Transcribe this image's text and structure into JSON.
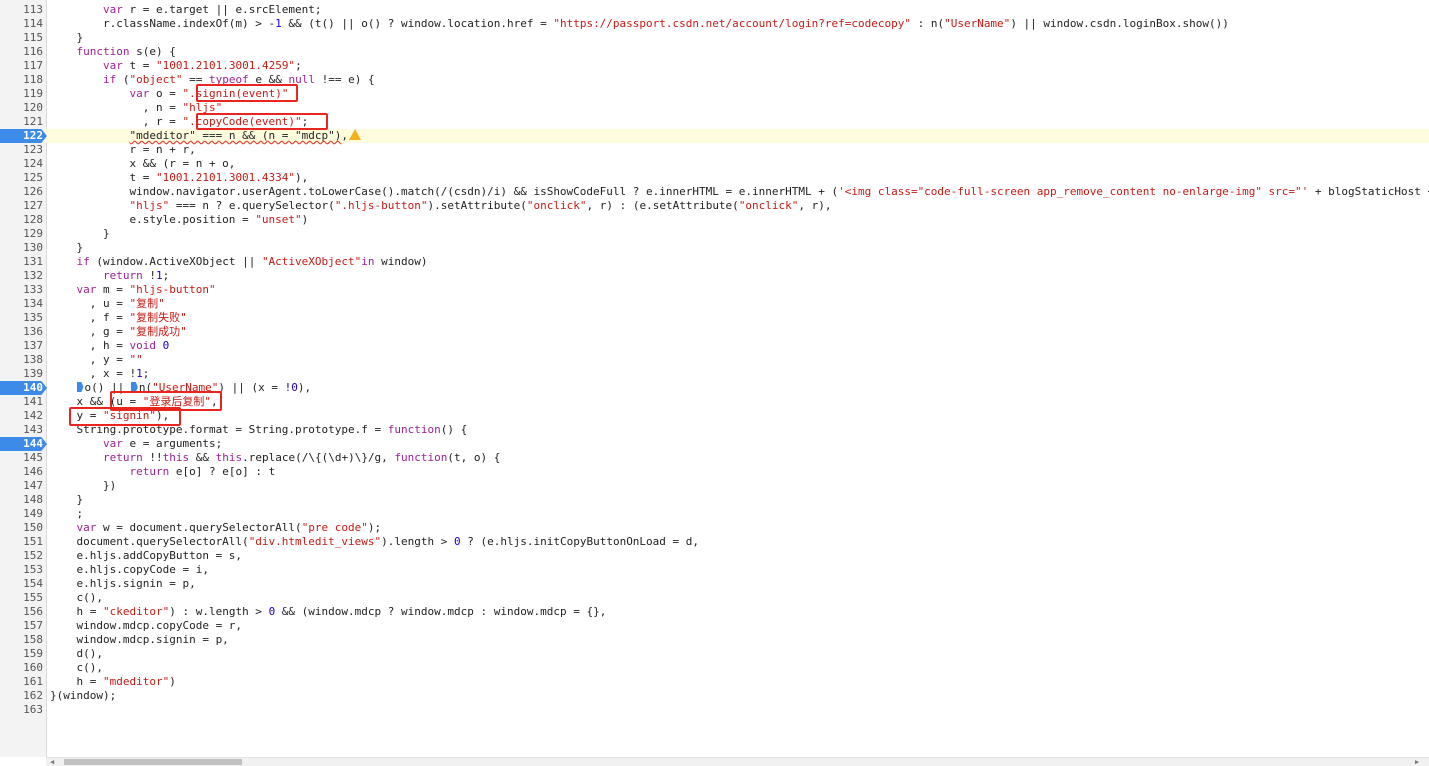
{
  "editor": {
    "highlighted_line": 122,
    "breakpoint_lines": [
      122,
      140,
      144
    ],
    "lines": [
      {
        "n": "113",
        "tokens": [
          [
            "p",
            "        "
          ],
          [
            "k",
            "var"
          ],
          [
            "p",
            " r = e.target || e.srcElement;"
          ]
        ]
      },
      {
        "n": "114",
        "tokens": [
          [
            "p",
            "        r.className.indexOf(m) > -"
          ],
          [
            "n",
            "1"
          ],
          [
            "p",
            " && (t() || o() ? window.location.href = "
          ],
          [
            "s",
            "\"https://passport.csdn.net/account/login?ref=codecopy\""
          ],
          [
            "p",
            " : n("
          ],
          [
            "s",
            "\"UserName\""
          ],
          [
            "p",
            ") || window.csdn.loginBox.show())"
          ]
        ]
      },
      {
        "n": "115",
        "tokens": [
          [
            "p",
            "    }"
          ]
        ]
      },
      {
        "n": "116",
        "tokens": [
          [
            "p",
            "    "
          ],
          [
            "k",
            "function"
          ],
          [
            "p",
            " s(e) {"
          ]
        ]
      },
      {
        "n": "117",
        "tokens": [
          [
            "p",
            "        "
          ],
          [
            "k",
            "var"
          ],
          [
            "p",
            " t = "
          ],
          [
            "s",
            "\"1001.2101.3001.4259\""
          ],
          [
            "p",
            ";"
          ]
        ]
      },
      {
        "n": "118",
        "tokens": [
          [
            "p",
            "        "
          ],
          [
            "k",
            "if"
          ],
          [
            "p",
            " ("
          ],
          [
            "s",
            "\"object\""
          ],
          [
            "p",
            " == "
          ],
          [
            "k",
            "typeof"
          ],
          [
            "p",
            " e && "
          ],
          [
            "k",
            "null"
          ],
          [
            "p",
            " !== e) {"
          ]
        ]
      },
      {
        "n": "119",
        "tokens": [
          [
            "p",
            "            "
          ],
          [
            "k",
            "var"
          ],
          [
            "p",
            " o = "
          ],
          [
            "s",
            "\".signin(event)\""
          ]
        ]
      },
      {
        "n": "120",
        "tokens": [
          [
            "p",
            "              , n = "
          ],
          [
            "s",
            "\"hljs\""
          ]
        ]
      },
      {
        "n": "121",
        "tokens": [
          [
            "p",
            "              , r = "
          ],
          [
            "s",
            "\".copyCode(event)\""
          ],
          [
            "p",
            ";"
          ]
        ]
      },
      {
        "n": "122",
        "tokens": [
          [
            "p",
            "            "
          ],
          [
            "sq",
            "\"mdeditor\" === n && (n = \"mdcp\")"
          ],
          [
            "p",
            ","
          ],
          [
            "warn",
            ""
          ]
        ]
      },
      {
        "n": "123",
        "tokens": [
          [
            "p",
            "            r = n + r,"
          ]
        ]
      },
      {
        "n": "124",
        "tokens": [
          [
            "p",
            "            x && (r = n + o,"
          ]
        ]
      },
      {
        "n": "125",
        "tokens": [
          [
            "p",
            "            t = "
          ],
          [
            "s",
            "\"1001.2101.3001.4334\""
          ],
          [
            "p",
            "),"
          ]
        ]
      },
      {
        "n": "126",
        "tokens": [
          [
            "p",
            "            window.navigator.userAgent.toLowerCase().match(/(csdn)/i) && isShowCodeFull ? e.innerHTML = e.innerHTML + ("
          ],
          [
            "s",
            "'<img class=\"code-full-screen app_remove_content no-enlarge-img\" src=\"'"
          ],
          [
            "p",
            " + blogStaticHost +"
          ]
        ]
      },
      {
        "n": "127",
        "tokens": [
          [
            "p",
            "            "
          ],
          [
            "s",
            "\"hljs\""
          ],
          [
            "p",
            " === n ? e.querySelector("
          ],
          [
            "s",
            "\".hljs-button\""
          ],
          [
            "p",
            ").setAttribute("
          ],
          [
            "s",
            "\"onclick\""
          ],
          [
            "p",
            ", r) : (e.setAttribute("
          ],
          [
            "s",
            "\"onclick\""
          ],
          [
            "p",
            ", r),"
          ]
        ]
      },
      {
        "n": "128",
        "tokens": [
          [
            "p",
            "            e.style.position = "
          ],
          [
            "s",
            "\"unset\""
          ],
          [
            "p",
            ")"
          ]
        ]
      },
      {
        "n": "129",
        "tokens": [
          [
            "p",
            "        }"
          ]
        ]
      },
      {
        "n": "130",
        "tokens": [
          [
            "p",
            "    }"
          ]
        ]
      },
      {
        "n": "131",
        "tokens": [
          [
            "p",
            "    "
          ],
          [
            "k",
            "if"
          ],
          [
            "p",
            " (window.ActiveXObject || "
          ],
          [
            "s",
            "\"ActiveXObject\""
          ],
          [
            "k",
            "in"
          ],
          [
            "p",
            " window)"
          ]
        ]
      },
      {
        "n": "132",
        "tokens": [
          [
            "p",
            "        "
          ],
          [
            "k",
            "return"
          ],
          [
            "p",
            " !"
          ],
          [
            "n",
            "1"
          ],
          [
            "p",
            ";"
          ]
        ]
      },
      {
        "n": "133",
        "tokens": [
          [
            "p",
            "    "
          ],
          [
            "k",
            "var"
          ],
          [
            "p",
            " m = "
          ],
          [
            "s",
            "\"hljs-button\""
          ]
        ]
      },
      {
        "n": "134",
        "tokens": [
          [
            "p",
            "      , u = "
          ],
          [
            "s",
            "\"复制\""
          ]
        ]
      },
      {
        "n": "135",
        "tokens": [
          [
            "p",
            "      , f = "
          ],
          [
            "s",
            "\"复制失败\""
          ]
        ]
      },
      {
        "n": "136",
        "tokens": [
          [
            "p",
            "      , g = "
          ],
          [
            "s",
            "\"复制成功\""
          ]
        ]
      },
      {
        "n": "137",
        "tokens": [
          [
            "p",
            "      , h = "
          ],
          [
            "k",
            "void"
          ],
          [
            "p",
            " "
          ],
          [
            "n",
            "0"
          ]
        ]
      },
      {
        "n": "138",
        "tokens": [
          [
            "p",
            "      , y = "
          ],
          [
            "s",
            "\"\""
          ]
        ]
      },
      {
        "n": "139",
        "tokens": [
          [
            "p",
            "      , x = !"
          ],
          [
            "n",
            "1"
          ],
          [
            "p",
            ";"
          ]
        ]
      },
      {
        "n": "140",
        "tokens": [
          [
            "p",
            "    "
          ],
          [
            "ibp",
            ""
          ],
          [
            "p",
            "o() || "
          ],
          [
            "ibp",
            ""
          ],
          [
            "p",
            "n("
          ],
          [
            "s",
            "\"UserName\""
          ],
          [
            "p",
            ") || (x = !"
          ],
          [
            "n",
            "0"
          ],
          [
            "p",
            "),"
          ]
        ]
      },
      {
        "n": "141",
        "tokens": [
          [
            "p",
            "    x && (u = "
          ],
          [
            "s",
            "\"登录后复制\""
          ],
          [
            "p",
            ","
          ]
        ]
      },
      {
        "n": "142",
        "tokens": [
          [
            "p",
            "    y = "
          ],
          [
            "s",
            "\"signin\""
          ],
          [
            "p",
            "),"
          ]
        ]
      },
      {
        "n": "143",
        "tokens": [
          [
            "p",
            "    String.prototype.format = String.prototype.f = "
          ],
          [
            "k",
            "function"
          ],
          [
            "p",
            "() {"
          ]
        ]
      },
      {
        "n": "144",
        "tokens": [
          [
            "p",
            "        "
          ],
          [
            "k",
            "var"
          ],
          [
            "p",
            " e = arguments;"
          ]
        ]
      },
      {
        "n": "145",
        "tokens": [
          [
            "p",
            "        "
          ],
          [
            "k",
            "return"
          ],
          [
            "p",
            " !!"
          ],
          [
            "k",
            "this"
          ],
          [
            "p",
            " && "
          ],
          [
            "k",
            "this"
          ],
          [
            "p",
            ".replace(/\\{(\\d+)\\}/g, "
          ],
          [
            "k",
            "function"
          ],
          [
            "p",
            "(t, o) {"
          ]
        ]
      },
      {
        "n": "146",
        "tokens": [
          [
            "p",
            "            "
          ],
          [
            "k",
            "return"
          ],
          [
            "p",
            " e[o] ? e[o] : t"
          ]
        ]
      },
      {
        "n": "147",
        "tokens": [
          [
            "p",
            "        })"
          ]
        ]
      },
      {
        "n": "148",
        "tokens": [
          [
            "p",
            "    }"
          ]
        ]
      },
      {
        "n": "149",
        "tokens": [
          [
            "p",
            "    ;"
          ]
        ]
      },
      {
        "n": "150",
        "tokens": [
          [
            "p",
            "    "
          ],
          [
            "k",
            "var"
          ],
          [
            "p",
            " w = document.querySelectorAll("
          ],
          [
            "s",
            "\"pre code\""
          ],
          [
            "p",
            ");"
          ]
        ]
      },
      {
        "n": "151",
        "tokens": [
          [
            "p",
            "    document.querySelectorAll("
          ],
          [
            "s",
            "\"div.htmledit_views\""
          ],
          [
            "p",
            ").length > "
          ],
          [
            "n",
            "0"
          ],
          [
            "p",
            " ? (e.hljs.initCopyButtonOnLoad = d,"
          ]
        ]
      },
      {
        "n": "152",
        "tokens": [
          [
            "p",
            "    e.hljs.addCopyButton = s,"
          ]
        ]
      },
      {
        "n": "153",
        "tokens": [
          [
            "p",
            "    e.hljs.copyCode = i,"
          ]
        ]
      },
      {
        "n": "154",
        "tokens": [
          [
            "p",
            "    e.hljs.signin = p,"
          ]
        ]
      },
      {
        "n": "155",
        "tokens": [
          [
            "p",
            "    c(),"
          ]
        ]
      },
      {
        "n": "156",
        "tokens": [
          [
            "p",
            "    h = "
          ],
          [
            "s",
            "\"ckeditor\""
          ],
          [
            "p",
            ") : w.length > "
          ],
          [
            "n",
            "0"
          ],
          [
            "p",
            " && (window.mdcp ? window.mdcp : window.mdcp = {},"
          ]
        ]
      },
      {
        "n": "157",
        "tokens": [
          [
            "p",
            "    window.mdcp.copyCode = r,"
          ]
        ]
      },
      {
        "n": "158",
        "tokens": [
          [
            "p",
            "    window.mdcp.signin = p,"
          ]
        ]
      },
      {
        "n": "159",
        "tokens": [
          [
            "p",
            "    d(),"
          ]
        ]
      },
      {
        "n": "160",
        "tokens": [
          [
            "p",
            "    c(),"
          ]
        ]
      },
      {
        "n": "161",
        "tokens": [
          [
            "p",
            "    h = "
          ],
          [
            "s",
            "\"mdeditor\""
          ],
          [
            "p",
            ")"
          ]
        ]
      },
      {
        "n": "162",
        "tokens": [
          [
            "p",
            "}(window);"
          ]
        ]
      },
      {
        "n": "163",
        "tokens": []
      }
    ]
  },
  "colors": {
    "keyword": "#9b2393",
    "string": "#c41a16",
    "number": "#1c00cf",
    "breakpoint": "#3d8be8",
    "highlight_line": "#fffbdd",
    "annotation_box": "#e8261f"
  },
  "icons": {
    "warning": "warning-icon",
    "breakpoint": "breakpoint-marker-icon"
  }
}
